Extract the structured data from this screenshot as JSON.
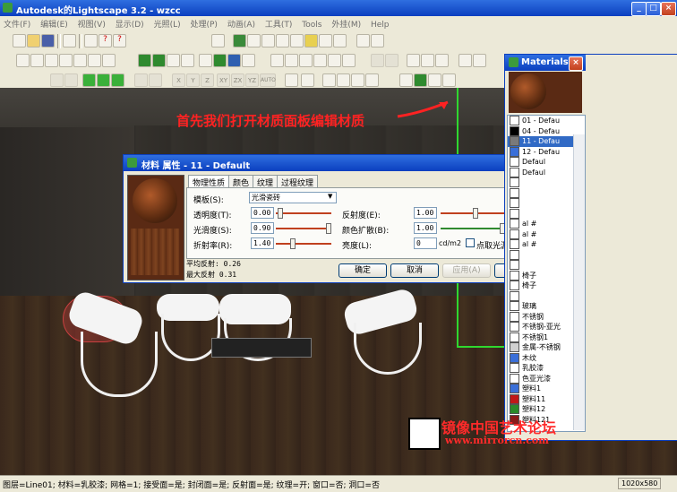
{
  "window": {
    "title": "Autodesk的Lightscape 3.2 - wzcc"
  },
  "menu": [
    "文件(F)",
    "编辑(E)",
    "视图(V)",
    "显示(D)",
    "光照(L)",
    "处理(P)",
    "动画(A)",
    "工具(T)",
    "Tools",
    "外挂(M)",
    "Help"
  ],
  "toolbar_text_buttons": [
    "X",
    "Y",
    "Z",
    "XY",
    "ZX",
    "YZ",
    "AUTO"
  ],
  "annotation": "首先我们打开材质面板编辑材质",
  "material_dialog": {
    "title": "材料 属性 - 11 - Default",
    "tabs": [
      "物理性质",
      "颜色",
      "纹理",
      "过程纹理"
    ],
    "template_label": "模板(S):",
    "template_value": "光滑瓷砖",
    "transparency_label": "透明度(T):",
    "transparency_value": "0.00",
    "reflectance_label": "反射度(E):",
    "reflectance_value": "1.00",
    "smoothness_label": "光滑度(S):",
    "smoothness_value": "0.90",
    "color_bleed_label": "颜色扩散(B):",
    "color_bleed_value": "1.00",
    "refraction_label": "折射率(R):",
    "refraction_value": "1.40",
    "luminance_label": "亮度(L):",
    "luminance_value": "0",
    "luminance_unit": "cd/m2",
    "point_light_label": "点取光源(P)",
    "avg_reflect": "平均反射: 0.26",
    "max_reflect": "最大反射 0.31",
    "ok": "确定",
    "cancel": "取消",
    "apply": "应用(A)",
    "help": "帮助(H)"
  },
  "materials_panel": {
    "title": "Materials",
    "items": [
      {
        "label": "01 - Defau",
        "color": "#ffffff"
      },
      {
        "label": "04 - Defau",
        "color": "#000000"
      },
      {
        "label": "11 - Defau",
        "color": "#7a7a7a",
        "selected": true
      },
      {
        "label": "12 - Defau",
        "color": "#3a6fd8"
      },
      {
        "label": "Defaul",
        "color": "#ffffff"
      },
      {
        "label": "Defaul",
        "color": "#ffffff"
      },
      {
        "label": "",
        "color": "#ffffff"
      },
      {
        "label": "",
        "color": "#ffffff"
      },
      {
        "label": "",
        "color": "#ffffff"
      },
      {
        "label": "",
        "color": "#ffffff"
      },
      {
        "label": "al #",
        "color": "#ffffff"
      },
      {
        "label": "al #",
        "color": "#ffffff"
      },
      {
        "label": "al #",
        "color": "#ffffff"
      },
      {
        "label": "",
        "color": "#ffffff"
      },
      {
        "label": "",
        "color": "#ffffff"
      },
      {
        "label": "椅子",
        "color": "#ffffff"
      },
      {
        "label": "椅子",
        "color": "#ffffff"
      },
      {
        "label": "",
        "color": "#ffffff"
      },
      {
        "label": "玻璃",
        "color": "#ffffff"
      },
      {
        "label": "不锈钢",
        "color": "#ffffff"
      },
      {
        "label": "不锈钢-亚光",
        "color": "#ffffff"
      },
      {
        "label": "不锈钢1",
        "color": "#ffffff"
      },
      {
        "label": "金属-不锈钢",
        "color": "#d0d0d0"
      },
      {
        "label": "木纹",
        "color": "#3a6fd8"
      },
      {
        "label": "乳胶漆",
        "color": "#ffffff"
      },
      {
        "label": "色亚光漆",
        "color": "#ffffff"
      },
      {
        "label": "塑料1",
        "color": "#3a6fd8"
      },
      {
        "label": "塑料11",
        "color": "#c01818"
      },
      {
        "label": "塑料12",
        "color": "#2a8a2a"
      },
      {
        "label": "塑料121",
        "color": "#8a1a1a"
      }
    ]
  },
  "watermark": {
    "text": "镜像中国艺术论坛",
    "url": "www.mirrorcn.com"
  },
  "status": {
    "text": "图层=Line01; 材料=乳胶漆; 网格=1; 接受面=是; 封闭面=是; 反射面=是; 纹理=开; 窗口=否; 洞口=否",
    "size": "1020x580"
  }
}
